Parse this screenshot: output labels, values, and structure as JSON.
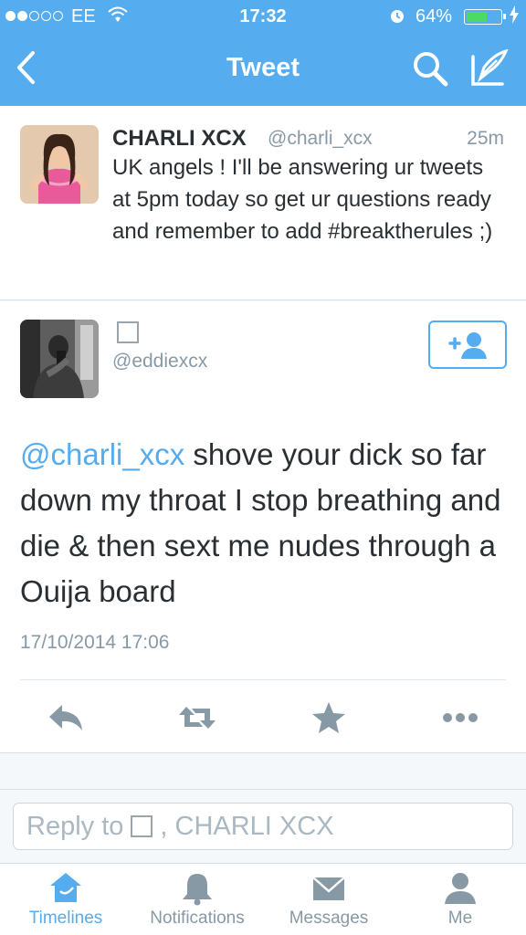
{
  "status_bar": {
    "carrier": "EE",
    "time": "17:32",
    "battery": "64%",
    "battery_level": 0.64
  },
  "nav": {
    "title": "Tweet"
  },
  "original_tweet": {
    "name": "CHARLI XCX",
    "handle": "@charli_xcx",
    "time": "25m",
    "text": "UK angels ! I'll be answering ur tweets at 5pm today so get ur questions ready and remember to add #breaktherules ;)"
  },
  "reply_tweet": {
    "handle": "@eddiexcx",
    "mention": "@charli_xcx",
    "text": " shove your dick so far down my throat I stop breathing and die & then sext me nudes through a Ouija board",
    "date": "17/10/2014 17:06"
  },
  "composer": {
    "prefix": "Reply to",
    "suffix": ", CHARLI XCX"
  },
  "tabs": [
    {
      "label": "Timelines",
      "icon": "home-icon",
      "active": true
    },
    {
      "label": "Notifications",
      "icon": "bell-icon",
      "active": false
    },
    {
      "label": "Messages",
      "icon": "envelope-icon",
      "active": false
    },
    {
      "label": "Me",
      "icon": "person-icon",
      "active": false
    }
  ],
  "colors": {
    "brand": "#55acee",
    "text": "#292f33",
    "muted": "#8899a6",
    "battery": "#4cd964"
  }
}
